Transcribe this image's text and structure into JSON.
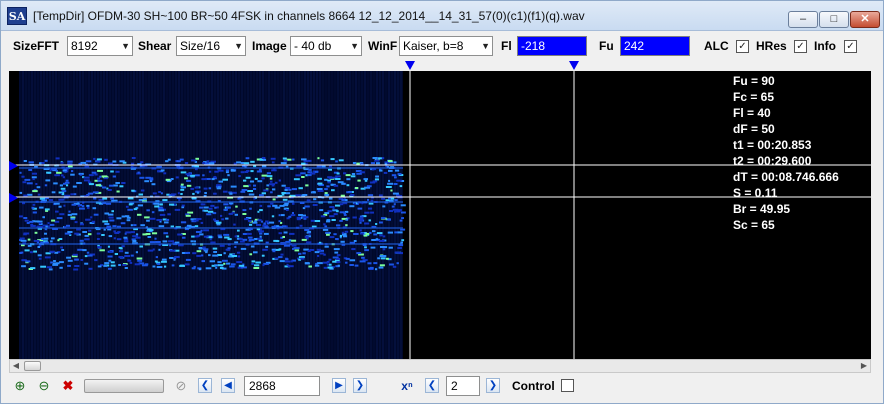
{
  "window": {
    "title": "[TempDir] OFDM-30 SH~100 BR~50 4FSK in channels 8664 12_12_2014__14_31_57(0)(c1)(f1)(q).wav",
    "app_icon_text": "SA"
  },
  "toolbar": {
    "sizefft_label": "SizeFFT",
    "sizefft_value": "8192",
    "shear_label": "Shear",
    "shear_value": "Size/16",
    "image_label": "Image",
    "image_value": "- 40 db",
    "winf_label": "WinF",
    "winf_value": "Kaiser, b=8",
    "fl_label": "Fl",
    "fl_value": "-218",
    "fu_label": "Fu",
    "fu_value": "242",
    "alc_label": "ALC",
    "alc_checked": true,
    "hres_label": "HRes",
    "hres_checked": true,
    "info_label": "Info",
    "info_checked": true
  },
  "info_panel": [
    "Fu = 90",
    "Fc = 65",
    "Fl = 40",
    "dF = 50",
    "t1 = 00:20.853",
    "t2 = 00:29.600",
    "dT = 00:08.746.666",
    "S = 0.11",
    "Br = 49.95",
    "Sc = 65"
  ],
  "bottombar": {
    "position_value": "2868",
    "multiplier_value": "2",
    "control_label": "Control",
    "control_checked": false
  },
  "colors": {
    "field_blue": "#0000ff",
    "marker_blue": "#0000ee",
    "spectrogram_low": "#00103a",
    "spectrogram_high": "#7dff9b"
  },
  "icons": [
    "zoom-in-icon",
    "zoom-out-icon",
    "zoom-reset-icon",
    "stop-icon",
    "first-icon",
    "prev-icon",
    "next-icon",
    "last-icon",
    "multiplier-icon"
  ]
}
